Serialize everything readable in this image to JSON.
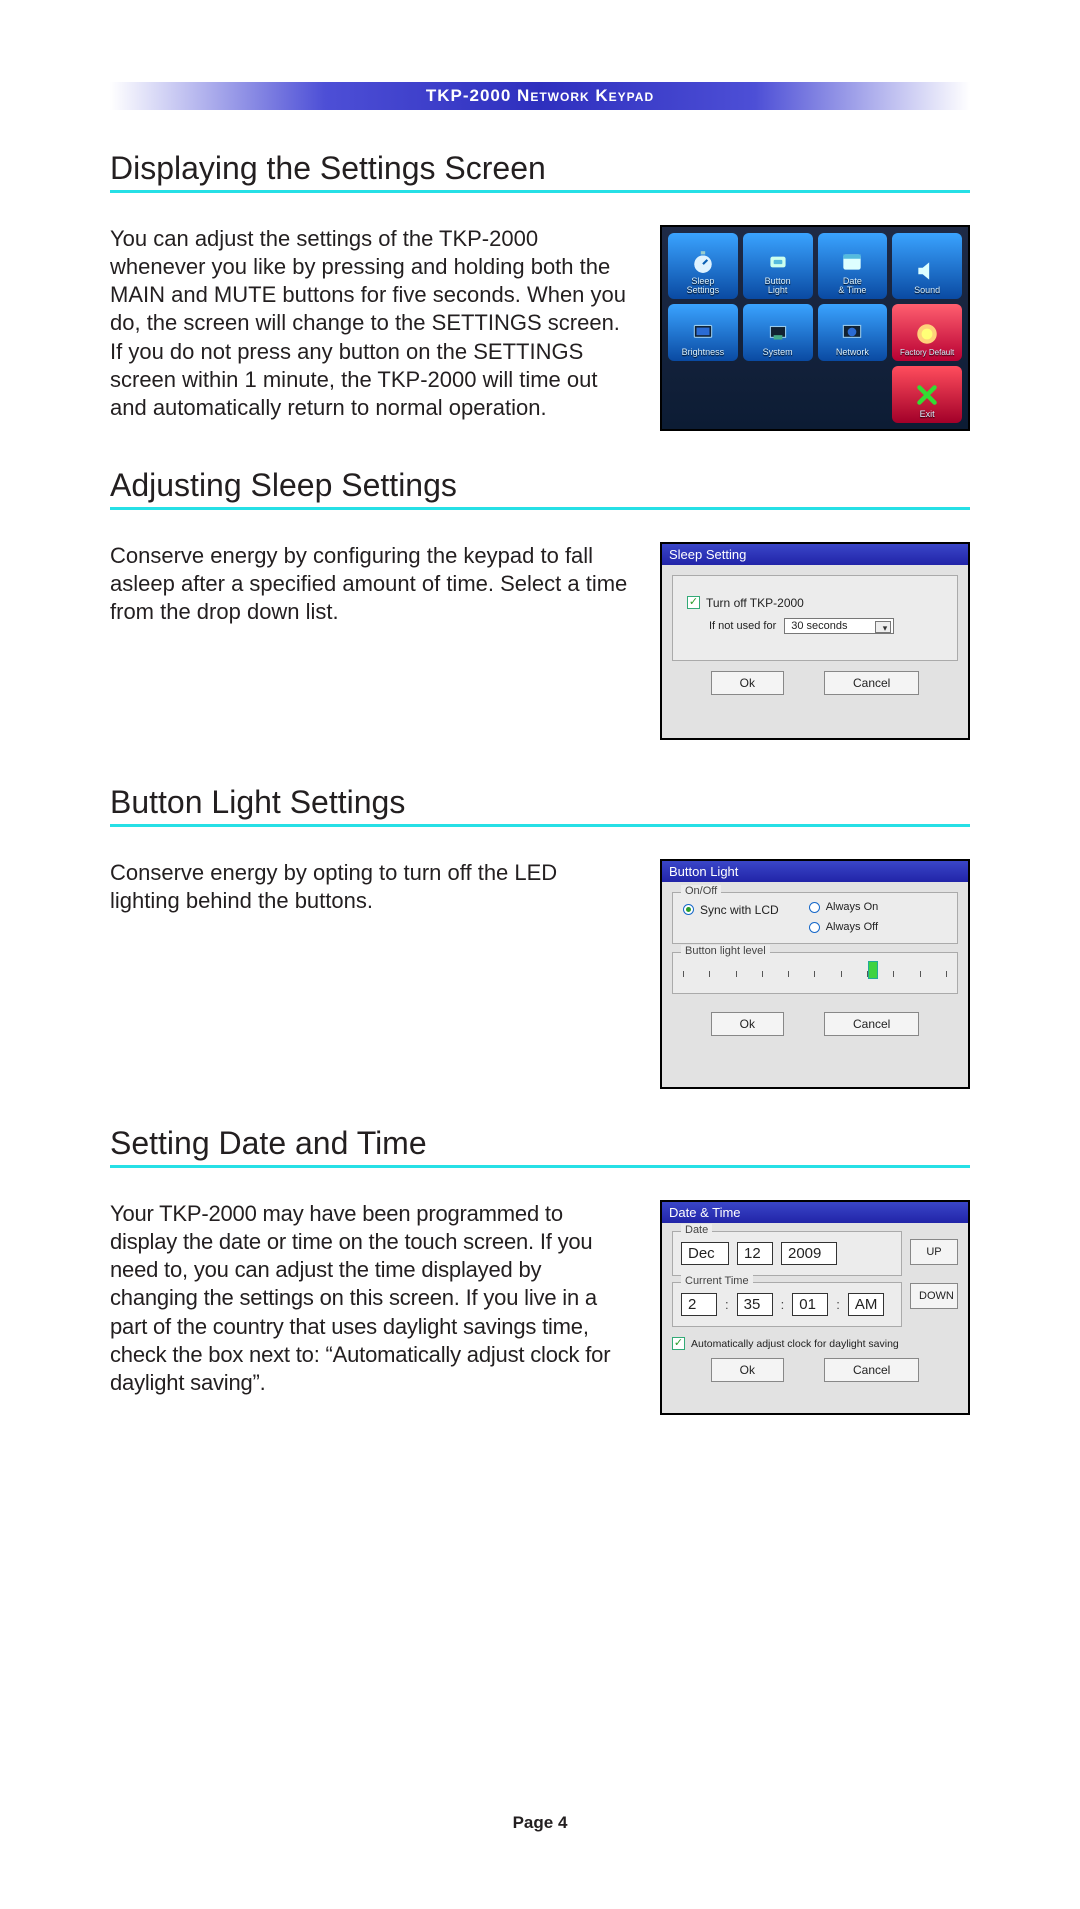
{
  "runner": "TKP-2000 Network Keypad",
  "page_label": "Page 4",
  "sections": {
    "settings": {
      "title": "Displaying the Settings Screen",
      "body": "You can adjust the settings of the TKP-2000 whenever you like by pressing and holding both the MAIN and MUTE buttons for five seconds. When you do, the screen will change to the SETTINGS screen. If you do not press any button on the SETTINGS screen within 1 minute, the TKP-2000 will time out and automatically return to normal operation.",
      "tiles": [
        {
          "l1": "Sleep",
          "l2": "Settings"
        },
        {
          "l1": "Button",
          "l2": "Light"
        },
        {
          "l1": "Date",
          "l2": "& Time"
        },
        {
          "l1": "Sound",
          "l2": ""
        },
        {
          "l1": "Brightness",
          "l2": ""
        },
        {
          "l1": "System",
          "l2": ""
        },
        {
          "l1": "Network",
          "l2": ""
        },
        {
          "l1": "Factory Default",
          "l2": ""
        },
        {
          "l1": "Exit",
          "l2": ""
        }
      ]
    },
    "sleep": {
      "title": "Adjusting Sleep Settings",
      "body": "Conserve energy by configuring the keypad to fall asleep after a specified amount of time. Select a time from the drop down list.",
      "dlg_title": "Sleep Setting",
      "check_label": "Turn off TKP-2000",
      "if_label": "If not used for",
      "select_value": "30 seconds",
      "ok": "Ok",
      "cancel": "Cancel"
    },
    "blight": {
      "title": "Button Light Settings",
      "body": "Conserve energy by opting to turn off the LED lighting behind the buttons.",
      "dlg_title": "Button Light",
      "group_onoff": "On/Off",
      "opt_sync": "Sync with LCD",
      "opt_on": "Always On",
      "opt_off": "Always Off",
      "group_level": "Button light level",
      "ok": "Ok",
      "cancel": "Cancel"
    },
    "dt": {
      "title": "Setting Date and Time",
      "body": "Your TKP-2000 may have been programmed to display the date or time on the touch screen. If you need to, you can adjust the time displayed by changing the settings on this screen. If you live in a part of the country that uses daylight savings time, check the box next to: “Automatically adjust clock for daylight saving”.",
      "dlg_title": "Date & Time",
      "group_date": "Date",
      "group_time": "Current Time",
      "month": "Dec",
      "day": "12",
      "year": "2009",
      "hour": "2",
      "min": "35",
      "sec": "01",
      "ampm": "AM",
      "up": "UP",
      "down": "DOWN",
      "dst": "Automatically adjust clock for daylight saving",
      "ok": "Ok",
      "cancel": "Cancel"
    }
  }
}
